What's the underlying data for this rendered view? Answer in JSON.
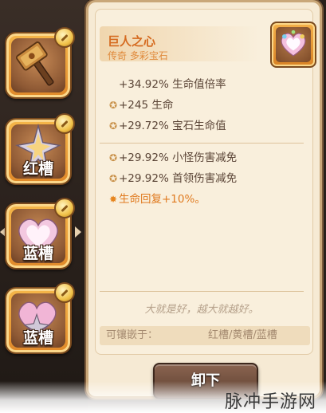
{
  "slots": [
    {
      "name": "hammer-weapon-slot",
      "label": ""
    },
    {
      "name": "red-socket-slot",
      "label": "红槽"
    },
    {
      "name": "blue-socket-slot-selected",
      "label": "蓝槽"
    },
    {
      "name": "blue-socket-slot",
      "label": "蓝槽"
    }
  ],
  "item": {
    "name": "巨人之心",
    "subtitle": "传奇 多彩宝石",
    "icon": "rainbow-heart-gem-icon"
  },
  "stats": {
    "primary": [
      {
        "bullet": "",
        "text": "+34.92% 生命值倍率"
      },
      {
        "bullet": "✪",
        "text": "+245 生命"
      },
      {
        "bullet": "✪",
        "text": "+29.72% 宝石生命值"
      }
    ],
    "secondary": [
      {
        "bullet": "✪",
        "text": "+29.92% 小怪伤害减免"
      },
      {
        "bullet": "✪",
        "text": "+29.92% 首领伤害减免"
      },
      {
        "bullet": "✸",
        "text": "生命回复+10%。"
      }
    ]
  },
  "motto": "大就是好，越大就越好。",
  "socket": {
    "label": "可镶嵌于：",
    "value": "红槽/黄槽/蓝槽"
  },
  "unequip_button": "卸下",
  "watermark": "脉冲手游网",
  "colors": {
    "panel_bg": "#f6ead4",
    "title": "#d56a1f",
    "accent": "#e07a1f",
    "stat_text": "#5a4436",
    "slot_orange": "#f0a844"
  }
}
